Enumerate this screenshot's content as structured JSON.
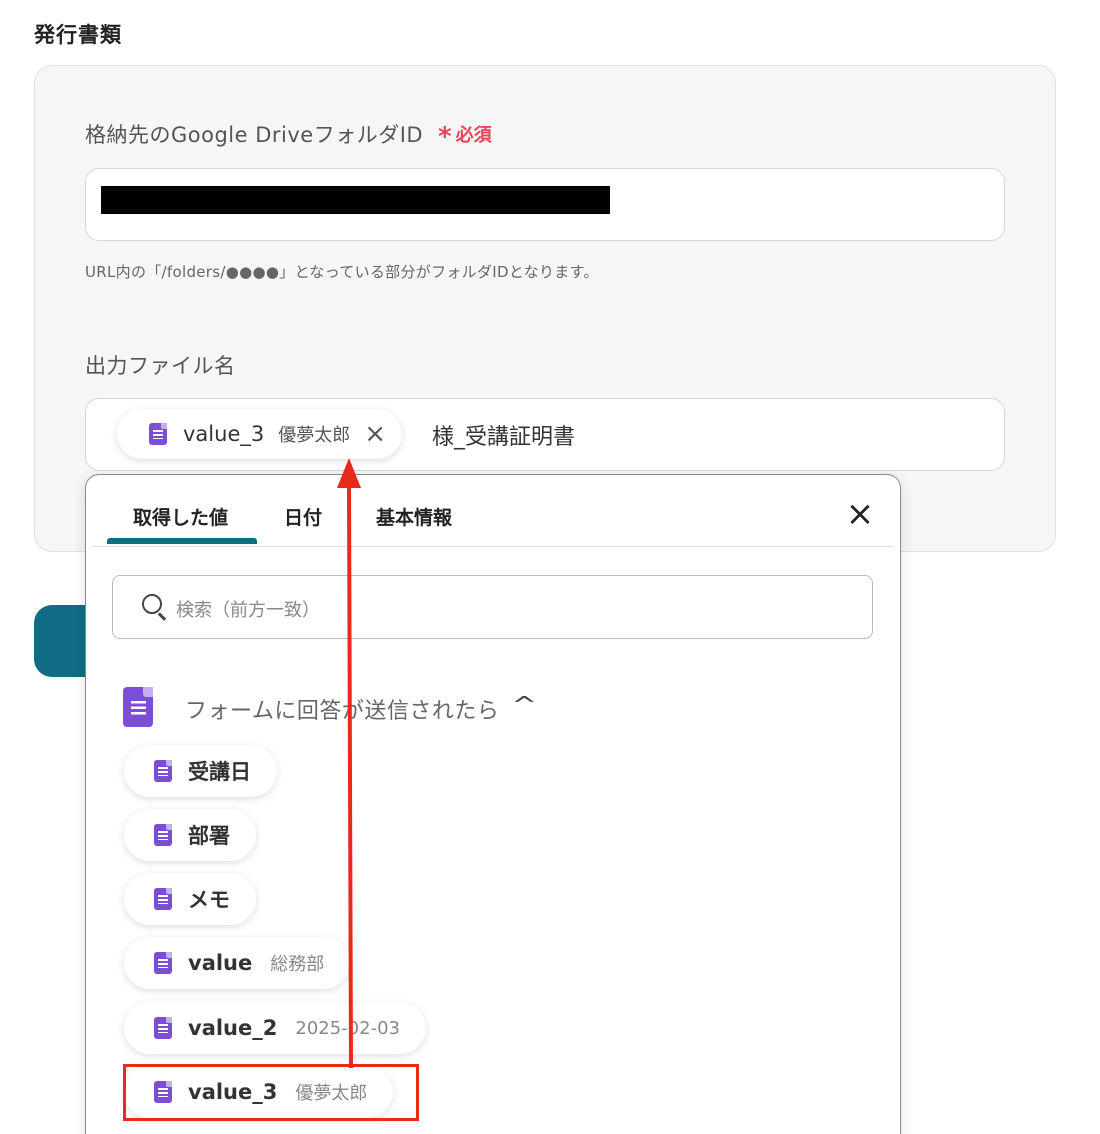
{
  "section_title": "発行書類",
  "folder_field": {
    "label": "格納先のGoogle Driveフォルダ​ID",
    "required_star": "*",
    "required_text": "必須",
    "hint": "URL内の「/folders/●●●●」となっている部分がフォルダIDとなります。"
  },
  "filename_field": {
    "label": "出力ファイル名",
    "token_name": "value_3",
    "token_value": "優夢太郎",
    "token_remove": "×",
    "suffix_text": "様_受講証明書"
  },
  "popup": {
    "tabs": [
      "取得した値",
      "日付",
      "基本情報"
    ],
    "active_tab": 0,
    "close_label": "×",
    "search_placeholder": "検索（前方一致）",
    "group_label": "フォームに回答が送信されたら",
    "group_chevron": "^",
    "items": [
      {
        "name": "受講日",
        "value": ""
      },
      {
        "name": "部署",
        "value": ""
      },
      {
        "name": "メモ",
        "value": ""
      },
      {
        "name": "value",
        "value": "総務部"
      },
      {
        "name": "value_2",
        "value": "2025-02-03"
      },
      {
        "name": "value_3",
        "value": "優夢太郎"
      }
    ],
    "highlighted_item": 5
  },
  "colors": {
    "accent": "#116c85",
    "required": "#e6455a",
    "form_icon": "#7c4dd6",
    "annotation": "#e8291c"
  }
}
